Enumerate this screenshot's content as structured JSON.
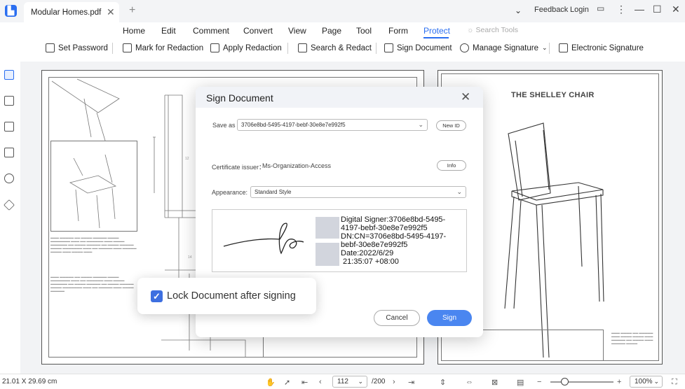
{
  "tab": {
    "title": "Modular Homes.pdf"
  },
  "titlebar": {
    "feedback": "Feedback",
    "login": "Login"
  },
  "menu": [
    "Home",
    "Edit",
    "Comment",
    "Convert",
    "View",
    "Page",
    "Tool",
    "Form",
    "Protect"
  ],
  "menu_active": "Protect",
  "search_tools": "Search Tools",
  "toolbar": {
    "set_password": "Set Password",
    "mark_redaction": "Mark for Redaction",
    "apply_redaction": "Apply Redaction",
    "search_redact": "Search & Redact",
    "sign_document": "Sign Document",
    "manage_signature": "Manage Signature",
    "electronic_signature": "Electronic Signature"
  },
  "document": {
    "right_title": "THE SHELLEY CHAIR"
  },
  "dialog": {
    "title": "Sign Document",
    "save_as_label": "Save as",
    "save_as_value": "3706e8bd-5495-4197-bebf-30e8e7e992f5",
    "new_id": "New ID",
    "cert_label": "Certificate issuer：",
    "cert_value": "Ms-Organization-Access",
    "info": "Info",
    "appearance_label": "Appearance:",
    "appearance_value": "Standard Style",
    "signature_lines": [
      "Digital Signer:3706e8bd-5495-",
      "4197-bebf-30e8e7e992f5",
      "DN:CN=3706e8bd-5495-4197-",
      "bebf-30e8e7e992f5",
      "Date:2022/6/29",
      " 21:35:07 +08:00"
    ],
    "cancel": "Cancel",
    "sign": "Sign"
  },
  "lock": {
    "label": "Lock Document after signing",
    "checked": true
  },
  "status": {
    "page_size": "21.01 X 29.69 cm",
    "page_current": "112",
    "page_total": "/200",
    "zoom": "100%"
  },
  "colors": {
    "accent": "#2a6ef0",
    "sign_button": "#4a86f0",
    "checkbox": "#3d6fe0"
  }
}
